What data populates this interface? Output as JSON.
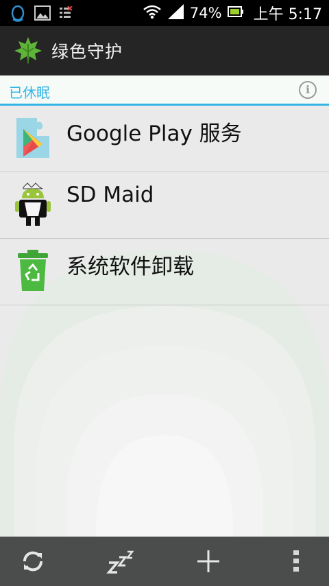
{
  "status_bar": {
    "battery": "74%",
    "time": "上午 5:17",
    "icons": [
      "qq-icon",
      "image-icon",
      "notification-icon",
      "wifi-icon",
      "signal-icon",
      "battery-icon"
    ]
  },
  "action_bar": {
    "title": "绿色守护",
    "icon": "greenify-leaf-icon"
  },
  "section": {
    "label": "已休眠",
    "accent": "#33b5e5"
  },
  "apps": [
    {
      "label": "Google Play 服务",
      "icon": "google-play-services-icon"
    },
    {
      "label": "SD Maid",
      "icon": "sd-maid-icon"
    },
    {
      "label": "系统软件卸载",
      "icon": "system-app-uninstaller-icon"
    }
  ],
  "bottom_bar": {
    "buttons": [
      "refresh-icon",
      "sleep-icon",
      "add-icon",
      "overflow-menu-icon"
    ]
  }
}
